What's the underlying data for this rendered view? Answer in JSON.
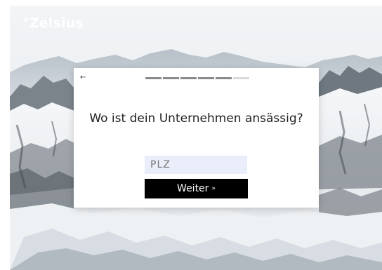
{
  "brand": {
    "logo_text": "°Zelsius"
  },
  "modal": {
    "back_icon": "arrow-left-icon",
    "back_glyph": "←",
    "progress": {
      "total_steps": 6,
      "completed_steps": 5
    },
    "question": "Wo ist dein Unternehmen ansässig?",
    "plz_input": {
      "placeholder": "PLZ",
      "value": ""
    },
    "submit": {
      "label": "Weiter",
      "arrow": "»"
    }
  },
  "colors": {
    "button_bg": "#000000",
    "input_bg": "#eaeefa",
    "progress_done": "#8a8a8a",
    "progress_todo": "#d9d9d9"
  }
}
